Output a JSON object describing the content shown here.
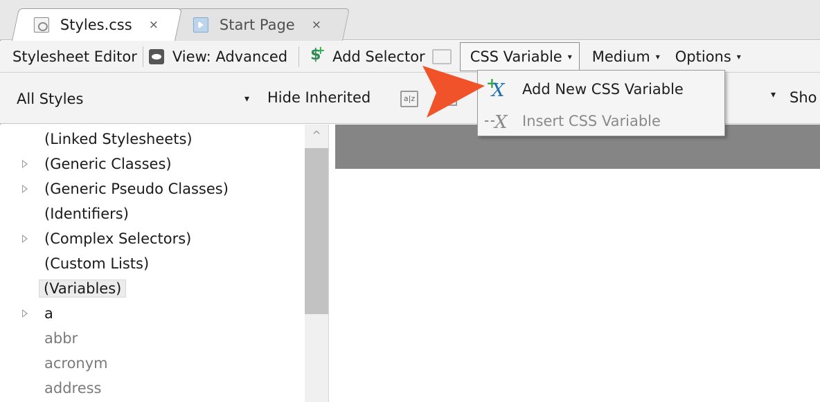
{
  "tabs": [
    {
      "label": "Styles.css",
      "close": "×",
      "icon": "css-file-icon",
      "active": true
    },
    {
      "label": "Start Page",
      "close": "×",
      "icon": "start-page-icon",
      "active": false
    }
  ],
  "toolbar": {
    "title": "Stylesheet Editor",
    "view_label": "View: Advanced",
    "add_selector_label": "Add Selector",
    "css_variable_label": "CSS Variable",
    "medium_label": "Medium",
    "options_label": "Options",
    "caret": "▾"
  },
  "toolbar2": {
    "filter_value": "All Styles",
    "hide_inherited_label": "Hide Inherited",
    "az_label": "a|z",
    "show_label": "Sho",
    "caret": "▾"
  },
  "tree": {
    "items": [
      {
        "label": "(Linked Stylesheets)",
        "expandable": false
      },
      {
        "label": "(Generic Classes)",
        "expandable": true
      },
      {
        "label": "(Generic Pseudo Classes)",
        "expandable": true
      },
      {
        "label": "(Identifiers)",
        "expandable": false
      },
      {
        "label": "(Complex Selectors)",
        "expandable": true
      },
      {
        "label": "(Custom Lists)",
        "expandable": false
      },
      {
        "label": "(Variables)",
        "expandable": false,
        "selected": true
      },
      {
        "label": "a",
        "expandable": true
      },
      {
        "label": "abbr",
        "expandable": false,
        "muted": true
      },
      {
        "label": "acronym",
        "expandable": false,
        "muted": true
      },
      {
        "label": "address",
        "expandable": false,
        "muted": true
      }
    ]
  },
  "scrollbar": {
    "up_glyph": "^"
  },
  "dropdown": {
    "items": [
      {
        "label": "Add New CSS Variable",
        "icon": "add-variable-icon",
        "enabled": true
      },
      {
        "label": "Insert CSS Variable",
        "icon": "insert-variable-icon",
        "enabled": false
      }
    ]
  },
  "colors": {
    "callout_arrow": "#f0522a",
    "panel_header": "#858585",
    "icon_blue": "#1f6fb0",
    "icon_green": "#2fa84a"
  }
}
